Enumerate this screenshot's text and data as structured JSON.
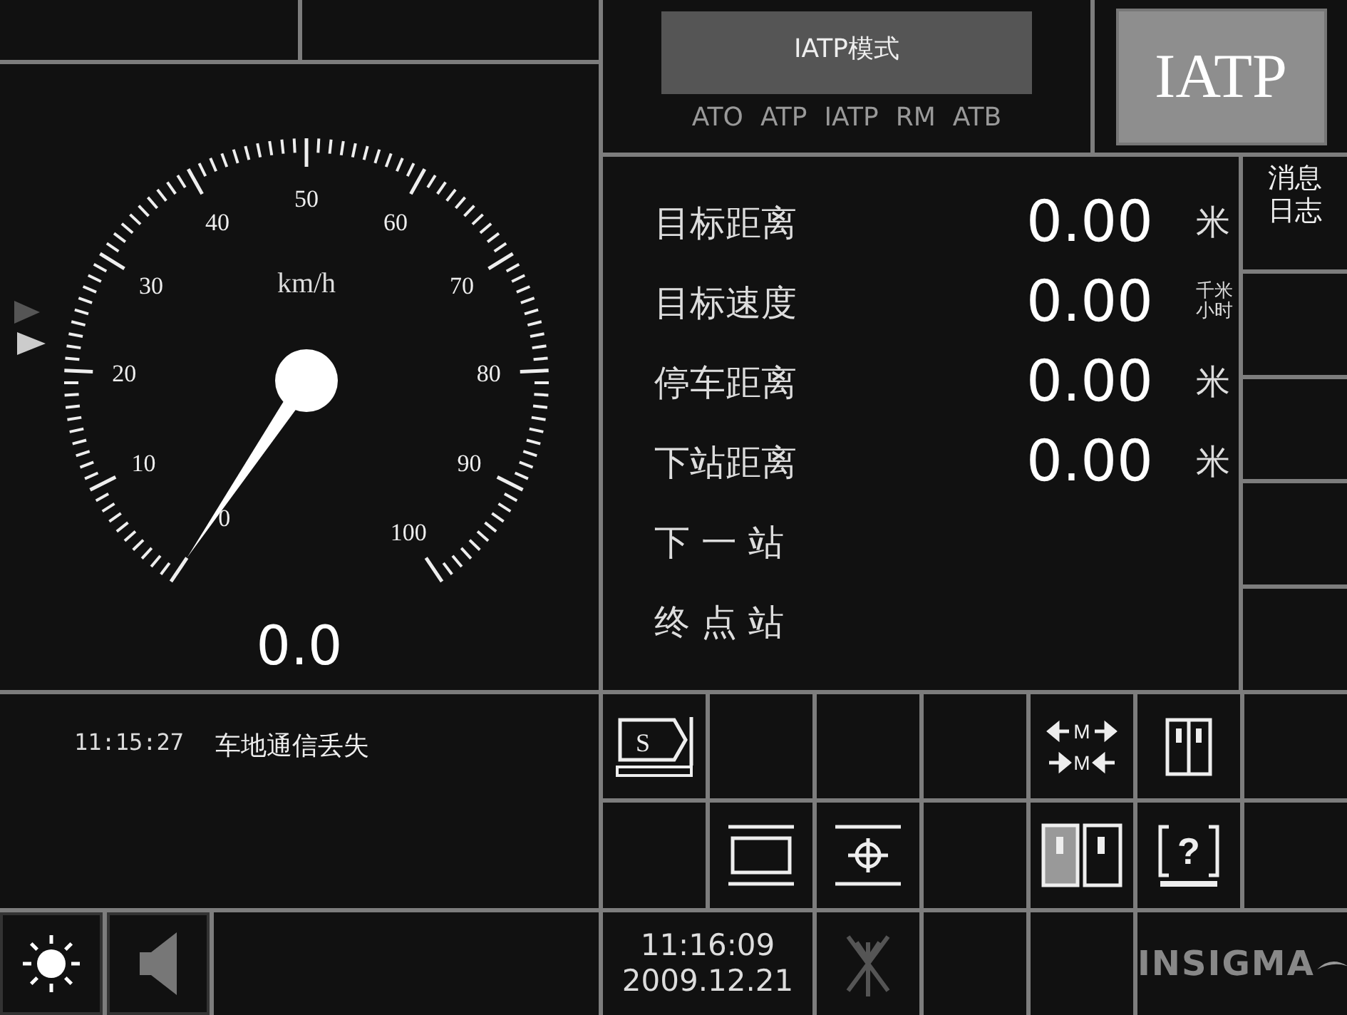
{
  "mode_panel": {
    "button": "IATP模式",
    "modes": [
      "ATO",
      "ATP",
      "IATP",
      "RM",
      "ATB"
    ],
    "current": "IATP"
  },
  "speedometer": {
    "unit": "km/h",
    "labels": [
      "0",
      "10",
      "20",
      "30",
      "40",
      "50",
      "60",
      "70",
      "80",
      "90",
      "100"
    ],
    "reading": "0.0"
  },
  "info_rows": [
    {
      "label": "目标距离",
      "value": "0.00",
      "unit": "米"
    },
    {
      "label": "目标速度",
      "value": "0.00",
      "unit": "千米小时"
    },
    {
      "label": "停车距离",
      "value": "0.00",
      "unit": "米"
    },
    {
      "label": "下站距离",
      "value": "0.00",
      "unit": "米"
    },
    {
      "label": "下 一 站"
    },
    {
      "label": "终 点 站"
    }
  ],
  "side_buttons": [
    {
      "label": "消息日志"
    }
  ],
  "message": {
    "time": "11:15:27",
    "text": "车地通信丢失"
  },
  "button_grid": [
    {
      "kind": "sign",
      "text": "S"
    },
    {
      "kind": "blank"
    },
    {
      "kind": "blank"
    },
    {
      "kind": "blank"
    },
    {
      "kind": "coupling",
      "texts": [
        "M",
        "M"
      ]
    },
    {
      "kind": "doors"
    },
    {
      "kind": "blank"
    },
    {
      "kind": "blank"
    },
    {
      "kind": "frame"
    },
    {
      "kind": "target"
    },
    {
      "kind": "blank"
    },
    {
      "kind": "door-select"
    },
    {
      "kind": "help",
      "text": "?"
    },
    {
      "kind": "blank"
    }
  ],
  "status_bar": {
    "time": "11:16:09",
    "date": "2009.12.21",
    "logo": "INSIGMA"
  }
}
